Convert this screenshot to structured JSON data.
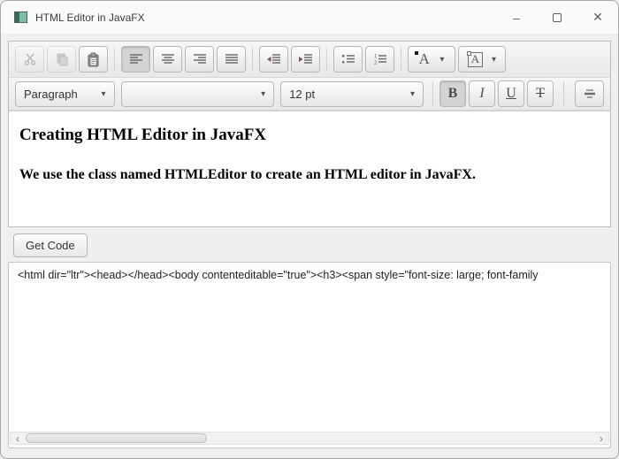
{
  "window": {
    "title": "HTML Editor in JavaFX",
    "minimize_glyph": "–",
    "close_glyph": "✕"
  },
  "toolbar_format": {
    "paragraph_value": "Paragraph",
    "font_family_value": "",
    "font_size_value": "12 pt",
    "bold_label": "B",
    "italic_label": "I",
    "underline_label": "U",
    "strikethrough_label": "T",
    "dropdown_arrow": "▾",
    "text_color_glyph": "A",
    "background_color_glyph": "A"
  },
  "toolbar_icons": [
    "cut-icon",
    "copy-icon",
    "paste-icon",
    "align-left-icon",
    "align-center-icon",
    "align-right-icon",
    "align-justify-icon",
    "outdent-icon",
    "indent-icon",
    "bulleted-list-icon",
    "numbered-list-icon",
    "text-color-icon",
    "background-color-icon",
    "horizontal-rule-icon"
  ],
  "toolbar_state": {
    "cut_disabled": true,
    "copy_disabled": true,
    "align_left_pressed": true,
    "bold_pressed": true
  },
  "editor_content": {
    "heading": "Creating HTML Editor in JavaFX",
    "body_text": "We use the class named HTMLEditor to create an HTML editor in JavaFX."
  },
  "get_code_button_label": "Get Code",
  "code_output": "<html dir=\"ltr\"><head></head><body contenteditable=\"true\"><h3><span style=\"font-size: large; font-family",
  "scrollbar": {
    "left_arrow": "‹",
    "right_arrow": "›"
  },
  "colors": {
    "window_background": "#f0efef",
    "titlebar_background": "#fbfafa",
    "pressed_button": "#d6d3d3",
    "app_icon_teal": "#7fbfa6",
    "app_icon_dark_teal": "#2f6f5c",
    "indent_arrow": "#7d5252"
  }
}
